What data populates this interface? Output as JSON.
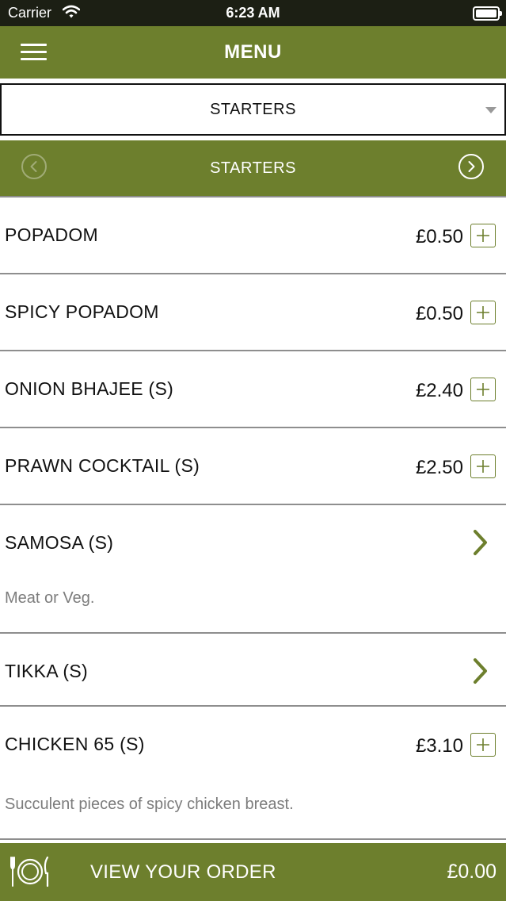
{
  "status_bar": {
    "carrier": "Carrier",
    "time": "6:23 AM"
  },
  "navbar": {
    "title": "MENU"
  },
  "category_select": {
    "selected": "STARTERS"
  },
  "category_bar": {
    "title": "STARTERS"
  },
  "items": [
    {
      "name": "POPADOM",
      "price": "£0.50"
    },
    {
      "name": "SPICY POPADOM",
      "price": "£0.50"
    },
    {
      "name": "ONION BHAJEE (S)",
      "price": "£2.40"
    },
    {
      "name": "PRAWN COCKTAIL (S)",
      "price": "£2.50"
    },
    {
      "name": "SAMOSA (S)",
      "description": "Meat or Veg."
    },
    {
      "name": "TIKKA (S)"
    },
    {
      "name": "CHICKEN 65 (S)",
      "price": "£3.10",
      "description": "Succulent pieces of spicy chicken breast."
    }
  ],
  "order_bar": {
    "label": "VIEW YOUR ORDER",
    "total": "£0.00"
  },
  "colors": {
    "accent": "#6d7f2d",
    "status_bar": "#1c1f14",
    "divider": "#8e8e8e",
    "description_text": "#7c7c7c"
  }
}
